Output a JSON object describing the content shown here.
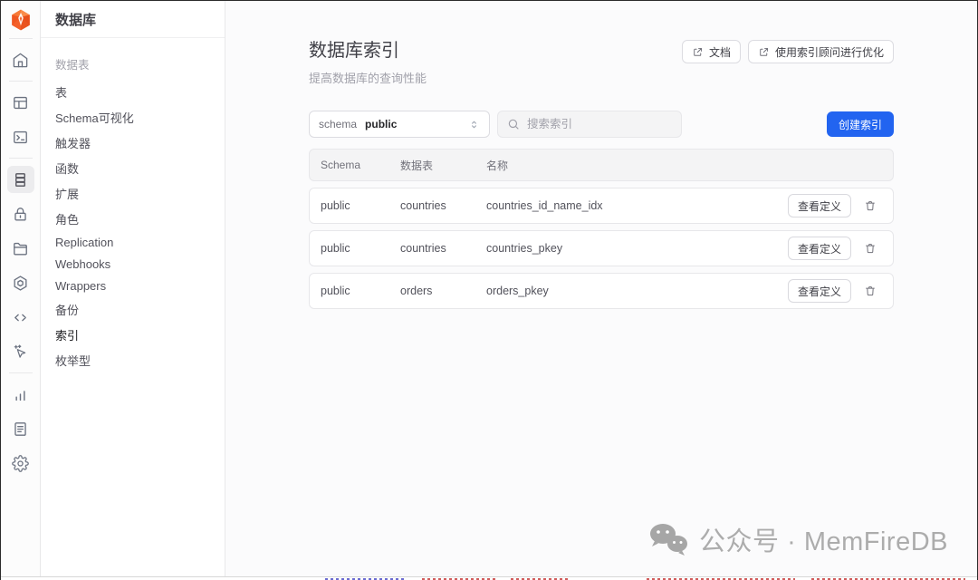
{
  "app": {
    "accent_blue": "#2264f0",
    "logo_name": "memfiredb-logo"
  },
  "icon_rail": {
    "items": [
      "home",
      "table-editor",
      "sql-editor",
      "database",
      "authentication",
      "storage",
      "edge-functions",
      "api",
      "ai-assistant",
      "reports",
      "logs",
      "settings"
    ],
    "active": "database"
  },
  "sidebar": {
    "title": "数据库",
    "section_label": "数据表",
    "items": [
      "表",
      "Schema可视化",
      "触发器",
      "函数",
      "扩展",
      "角色",
      "Replication",
      "Webhooks",
      "Wrappers",
      "备份",
      "索引",
      "枚举型"
    ],
    "active_item": "索引"
  },
  "header": {
    "title": "数据库索引",
    "subtitle": "提高数据库的查询性能",
    "docs_button": "文档",
    "advisor_button": "使用索引顾问进行优化"
  },
  "controls": {
    "schema_label": "schema",
    "schema_value": "public",
    "search_placeholder": "搜索索引",
    "create_button": "创建索引"
  },
  "table": {
    "columns": [
      "Schema",
      "数据表",
      "名称"
    ],
    "view_definition_label": "查看定义",
    "rows": [
      {
        "schema": "public",
        "table": "countries",
        "name": "countries_id_name_idx"
      },
      {
        "schema": "public",
        "table": "countries",
        "name": "countries_pkey"
      },
      {
        "schema": "public",
        "table": "orders",
        "name": "orders_pkey"
      }
    ]
  },
  "watermark": {
    "text": "公众号 · MemFireDB"
  }
}
